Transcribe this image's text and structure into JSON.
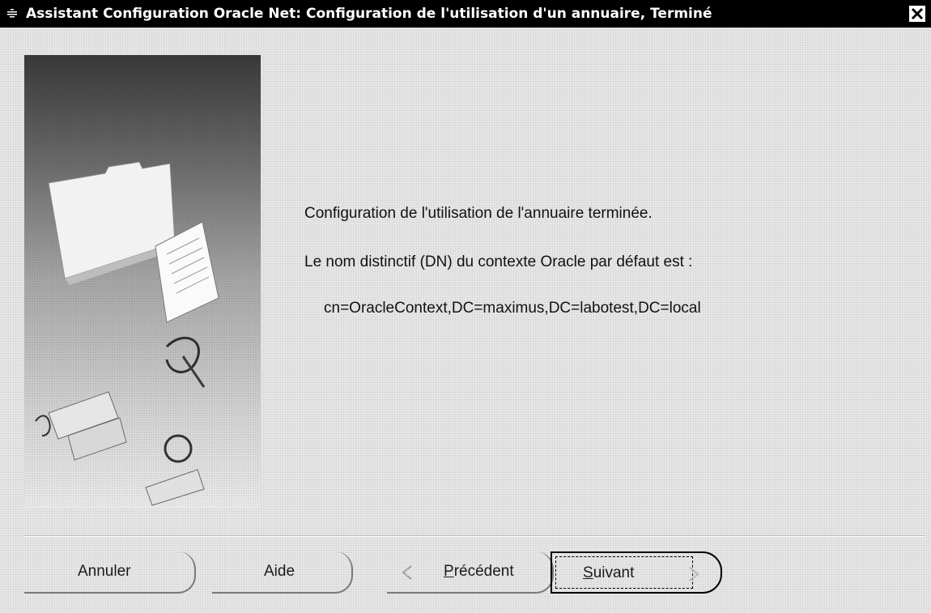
{
  "window": {
    "title": "Assistant Configuration Oracle Net: Configuration de l'utilisation d'un annuaire, Terminé",
    "icons": {
      "app": "oracle-wizard-icon",
      "close": "close-icon"
    }
  },
  "illustration": {
    "description_icon": "folder-documents-keys-illustration"
  },
  "content": {
    "completion_message": "Configuration de l'utilisation de l'annuaire terminée.",
    "dn_label": "Le nom distinctif (DN) du contexte Oracle par défaut est :",
    "dn_value": "cn=OracleContext,DC=maximus,DC=labotest,DC=local"
  },
  "buttons": {
    "cancel": "Annuler",
    "help": "Aide",
    "previous_mnemonic": "P",
    "previous_rest": "récédent",
    "next_mnemonic": "S",
    "next_rest": "uivant"
  },
  "colors": {
    "titlebar_bg": "#000000",
    "titlebar_fg": "#ffffff",
    "dialog_bg": "#e8e8e8"
  }
}
